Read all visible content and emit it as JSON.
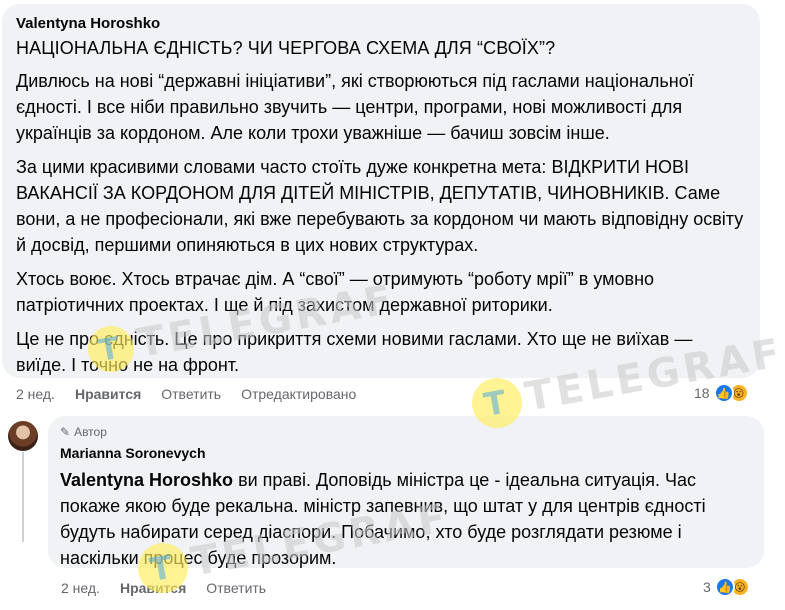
{
  "comment1": {
    "author": "Valentyna Horoshko",
    "headline": "НАЦІОНАЛЬНА ЄДНІСТЬ? ЧИ ЧЕРГОВА СХЕМА ДЛЯ “СВОЇХ”?",
    "paragraphs": [
      "Дивлюсь на нові “державні ініціативи”, які створюються під гаслами національної єдності. І все ніби правильно звучить — центри, програми, нові можливості для українців за кордоном. Але коли трохи уважніше — бачиш зовсім інше.",
      "За цими красивими словами часто стоїть дуже конкретна мета: ВІДКРИТИ НОВІ ВАКАНСІЇ ЗА КОРДОНОМ ДЛЯ ДІТЕЙ МІНІСТРІВ, ДЕПУТАТІВ, ЧИНОВНИКІВ. Саме вони, а не професіонали, які вже перебувають за кордоном чи мають відповідну освіту й досвід, першими опиняються в цих нових структурах.",
      "Хтось воює. Хтось втрачає дім. А “свої” — отримують “роботу мрії” в умовно патріотичних проектах. І ще й під захистом державної риторики.",
      "Це не про єдність. Це про прикриття схеми новими гаслами. Хто ще не виїхав — виїде. І точно не на фронт."
    ],
    "time": "2 нед.",
    "like_label": "Нравится",
    "reply_label": "Ответить",
    "edited_label": "Отредактировано",
    "reaction_count": "18",
    "reaction_icons": [
      "like-icon",
      "wow-icon"
    ]
  },
  "comment2": {
    "badge": "Автор",
    "author": "Marianna Soronevych",
    "mention": "Valentyna Horoshko",
    "text": " ви праві. Доповідь міністра це - ідеальна ситуація. Час покаже якою буде рекальна. міністр запевнив, що штат у для центрів єдності будуть набирати серед діаспори. Побачимо, хто буде розглядати резюме і наскільки процес буде прозорим.",
    "time": "2 нед.",
    "like_label": "Нравится",
    "reply_label": "Ответить",
    "reaction_count": "3",
    "reaction_icons": [
      "like-icon",
      "wow-icon"
    ]
  },
  "watermark": {
    "text": "TELEGRAF",
    "logo_letter": "T"
  },
  "colors": {
    "bubble": "#f0f2f5",
    "muted_text": "#65676b",
    "like_blue": "#1877f2",
    "wow_yellow": "#f7b125"
  }
}
